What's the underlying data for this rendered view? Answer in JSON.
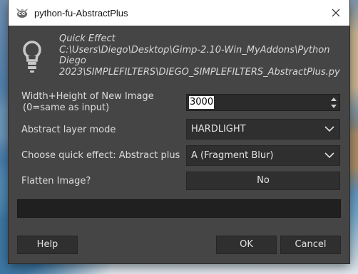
{
  "window": {
    "title": "python-fu-AbstractPlus"
  },
  "info": {
    "lines": [
      "Quick Effect",
      "C:\\Users\\Diego\\Desktop\\Gimp-2.10-Win_MyAddons\\Python",
      "Diego",
      "2023\\SIMPLEFILTERS\\DIEGO_SIMPLEFILTERS_AbstractPlus.py"
    ]
  },
  "fields": {
    "size": {
      "label_line1": "Width+Height of New Image",
      "label_line2": "(0=same as input)",
      "value": "3000"
    },
    "layer_mode": {
      "label": "Abstract layer mode",
      "value": "HARDLIGHT"
    },
    "quick_effect": {
      "label": "Choose quick effect: Abstract plus",
      "value": "A (Fragment Blur)"
    },
    "flatten": {
      "label": "Flatten Image?",
      "value": "No"
    }
  },
  "buttons": {
    "help": "Help",
    "ok": "OK",
    "cancel": "Cancel"
  },
  "icons": {
    "app": "gimp-wilber-icon",
    "close": "close-icon",
    "info": "lightbulb-icon",
    "spin_up": "spin-up-icon",
    "spin_down": "spin-down-icon",
    "dropdown": "chevron-down-icon"
  },
  "colors": {
    "dialog_bg": "#454545",
    "field_bg": "#2f2f2f",
    "progress_bg": "#202020",
    "text": "#dedede"
  }
}
